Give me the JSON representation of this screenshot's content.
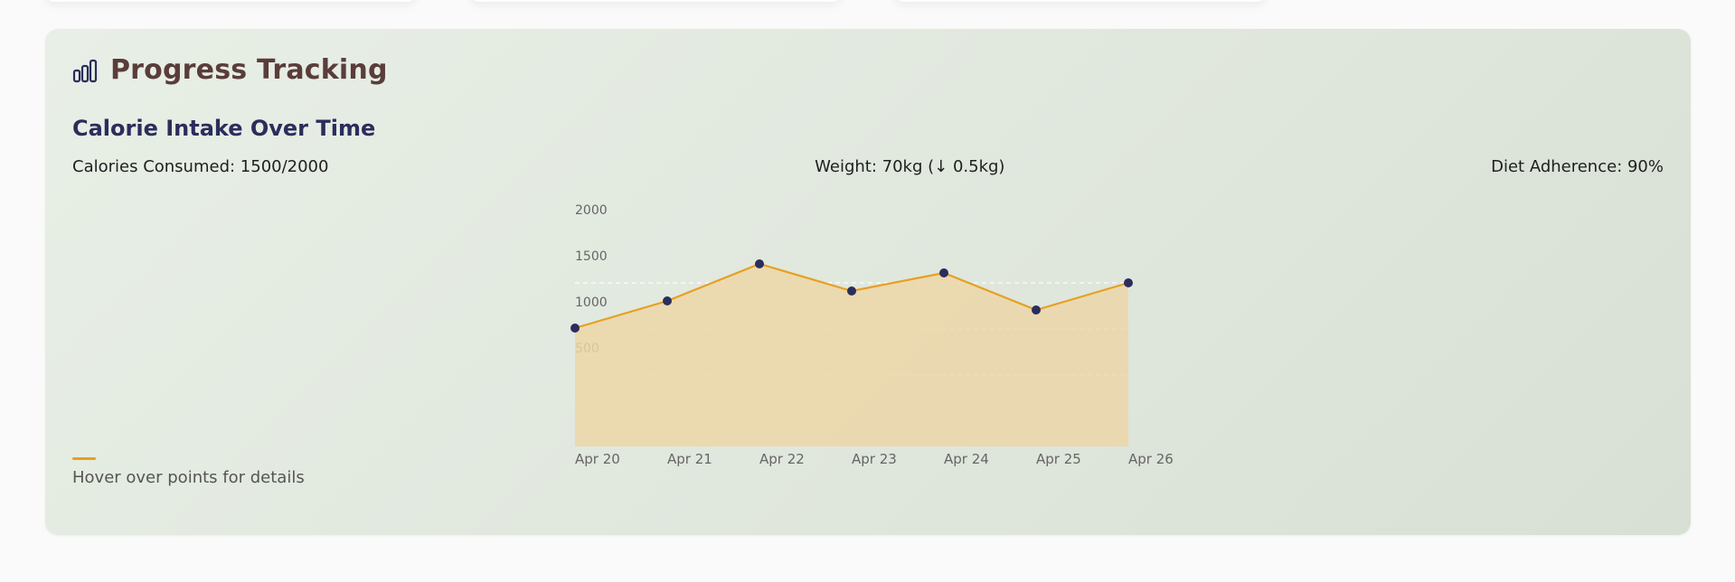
{
  "section": {
    "title": "Progress Tracking",
    "icon": "bar-chart-icon"
  },
  "chart_title": "Calorie Intake Over Time",
  "stats": {
    "calories": "Calories Consumed: 1500/2000",
    "weight": "Weight: 70kg (↓ 0.5kg)",
    "adherence": "Diet Adherence: 90%"
  },
  "hint": "Hover over points for details",
  "colors": {
    "accent": "#e6a021",
    "point": "#2b2d5c",
    "title": "#5a3d3a",
    "area": "#ecd6a8"
  },
  "chart_data": {
    "type": "area",
    "categories": [
      "Apr 20",
      "Apr 21",
      "Apr 22",
      "Apr 23",
      "Apr 24",
      "Apr 25",
      "Apr 26"
    ],
    "series": [
      {
        "values": [
          500,
          800,
          1200,
          900,
          1100,
          700,
          1000
        ]
      }
    ],
    "yticks": [
      2000,
      1500,
      1000,
      500
    ],
    "ylim": [
      0,
      2000
    ],
    "grid": true
  }
}
